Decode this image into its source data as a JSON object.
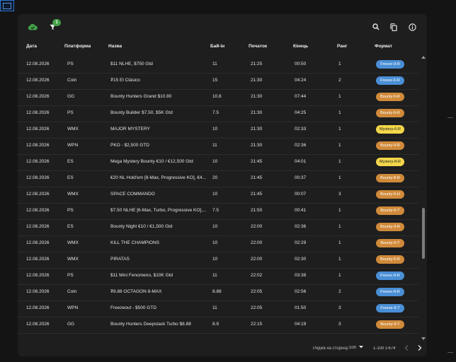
{
  "colors": {
    "Freeze": "#4a8fd6",
    "Bounty": "#d08a3a",
    "Mystery": "#f3d64a",
    "cloud": "#43a047",
    "badge": "#43a047"
  },
  "toolbar": {
    "cloud_icon": "cloud-sync-icon",
    "filter_icon": "filter-icon",
    "filter_badge": "1",
    "search_icon": "search-icon",
    "copy_icon": "copy-icon",
    "info_icon": "info-icon"
  },
  "columns": [
    "Дата",
    "Платформа",
    "Назва",
    "Бай-ін",
    "Початок",
    "Кінець",
    "Ранг",
    "Формат"
  ],
  "rows": [
    {
      "date": "12.08.2026",
      "platform": "PS",
      "name": "$11 NLHE, $750 Gtd",
      "buyin": "11",
      "start": "21:25",
      "end": "00:50",
      "rank": "1",
      "format": "Freeze-9-R",
      "ftype": "Freeze"
    },
    {
      "date": "12.08.2026",
      "platform": "Coin",
      "name": "₮15 El Clásico",
      "buyin": "15",
      "start": "21:30",
      "end": "04:24",
      "rank": "2",
      "format": "Freeze-6-R",
      "ftype": "Freeze"
    },
    {
      "date": "12.08.2026",
      "platform": "GG",
      "name": "Bounty Hunters Grand $10.80",
      "buyin": "10.8",
      "start": "21:30",
      "end": "07:44",
      "rank": "1",
      "format": "Bounty-9-R",
      "ftype": "Bounty"
    },
    {
      "date": "12.08.2026",
      "platform": "PS",
      "name": "Bounty Builder $7.50, $5K Gtd",
      "buyin": "7.5",
      "start": "21:30",
      "end": "04:25",
      "rank": "1",
      "format": "Bounty-9-R",
      "ftype": "Bounty"
    },
    {
      "date": "12.08.2026",
      "platform": "WMX",
      "name": "MAJOR MYSTERY",
      "buyin": "10",
      "start": "21:30",
      "end": "02:33",
      "rank": "1",
      "format": "Mystery-6-R",
      "ftype": "Mystery"
    },
    {
      "date": "12.08.2026",
      "platform": "WPN",
      "name": "PKO - $2,500 GTD",
      "buyin": "11",
      "start": "21:30",
      "end": "02:36",
      "rank": "1",
      "format": "Bounty-9-R",
      "ftype": "Bounty"
    },
    {
      "date": "12.08.2026",
      "platform": "ES",
      "name": "Mega Mystery Bounty €10 / €12,500 Gtd",
      "buyin": "10",
      "start": "21:45",
      "end": "04:01",
      "rank": "1",
      "format": "Mystery-8-R",
      "ftype": "Mystery"
    },
    {
      "date": "12.08.2026",
      "platform": "ES",
      "name": "€20 NL Hold'em [8-Max, Progressive KO], €4...",
      "buyin": "20",
      "start": "21:45",
      "end": "00:37",
      "rank": "1",
      "format": "Bounty-8-R",
      "ftype": "Bounty"
    },
    {
      "date": "12.08.2026",
      "platform": "WMX",
      "name": "SPACE COMMANDO",
      "buyin": "10",
      "start": "21:45",
      "end": "00:07",
      "rank": "3",
      "format": "Bounty-6-H",
      "ftype": "Bounty"
    },
    {
      "date": "12.08.2026",
      "platform": "PS",
      "name": "$7.50 NLHE [6-Max, Turbo, Progressive KO],...",
      "buyin": "7.5",
      "start": "21:50",
      "end": "00:41",
      "rank": "1",
      "format": "Bounty-6-T",
      "ftype": "Bounty"
    },
    {
      "date": "12.08.2026",
      "platform": "ES",
      "name": "Bounty Night €10 / €1,500 Gtd",
      "buyin": "10",
      "start": "22:00",
      "end": "02:36",
      "rank": "1",
      "format": "Bounty-9-R",
      "ftype": "Bounty"
    },
    {
      "date": "12.08.2026",
      "platform": "WMX",
      "name": "KILL THE CHAMPIONS",
      "buyin": "10",
      "start": "22:00",
      "end": "02:29",
      "rank": "1",
      "format": "Bounty-6-T",
      "ftype": "Bounty"
    },
    {
      "date": "12.08.2026",
      "platform": "WMX",
      "name": "PIRATAS",
      "buyin": "10",
      "start": "22:00",
      "end": "02:30",
      "rank": "1",
      "format": "Bounty-6-R",
      "ftype": "Bounty"
    },
    {
      "date": "12.08.2026",
      "platform": "PS",
      "name": "$11 Mini Fenomeno, $10K Gtd",
      "buyin": "11",
      "start": "22:02",
      "end": "03:38",
      "rank": "1",
      "format": "Freeze-9-R",
      "ftype": "Freeze"
    },
    {
      "date": "12.08.2026",
      "platform": "Coin",
      "name": "₮8.88 OCTAGON 8-MAX",
      "buyin": "8.88",
      "start": "22:05",
      "end": "02:56",
      "rank": "2",
      "format": "Freeze-8-R",
      "ftype": "Freeze"
    },
    {
      "date": "12.08.2026",
      "platform": "WPN",
      "name": "Freezeout - $500 GTD",
      "buyin": "11",
      "start": "22:05",
      "end": "01:50",
      "rank": "3",
      "format": "Freeze-9-T",
      "ftype": "Freeze"
    },
    {
      "date": "12.08.2026",
      "platform": "GG",
      "name": "Bounty Hunters Deepstack Turbo $8.88",
      "buyin": "8.9",
      "start": "22:15",
      "end": "04:19",
      "rank": "3",
      "format": "Bounty-9-T",
      "ftype": "Bounty"
    }
  ],
  "footer": {
    "rows_per_page_label": "Рядків на сторінці:",
    "rows_per_page_value": "100",
    "range": "1-100 з 674",
    "prev_icon": "chevron-left-icon",
    "next_icon": "chevron-right-icon"
  }
}
